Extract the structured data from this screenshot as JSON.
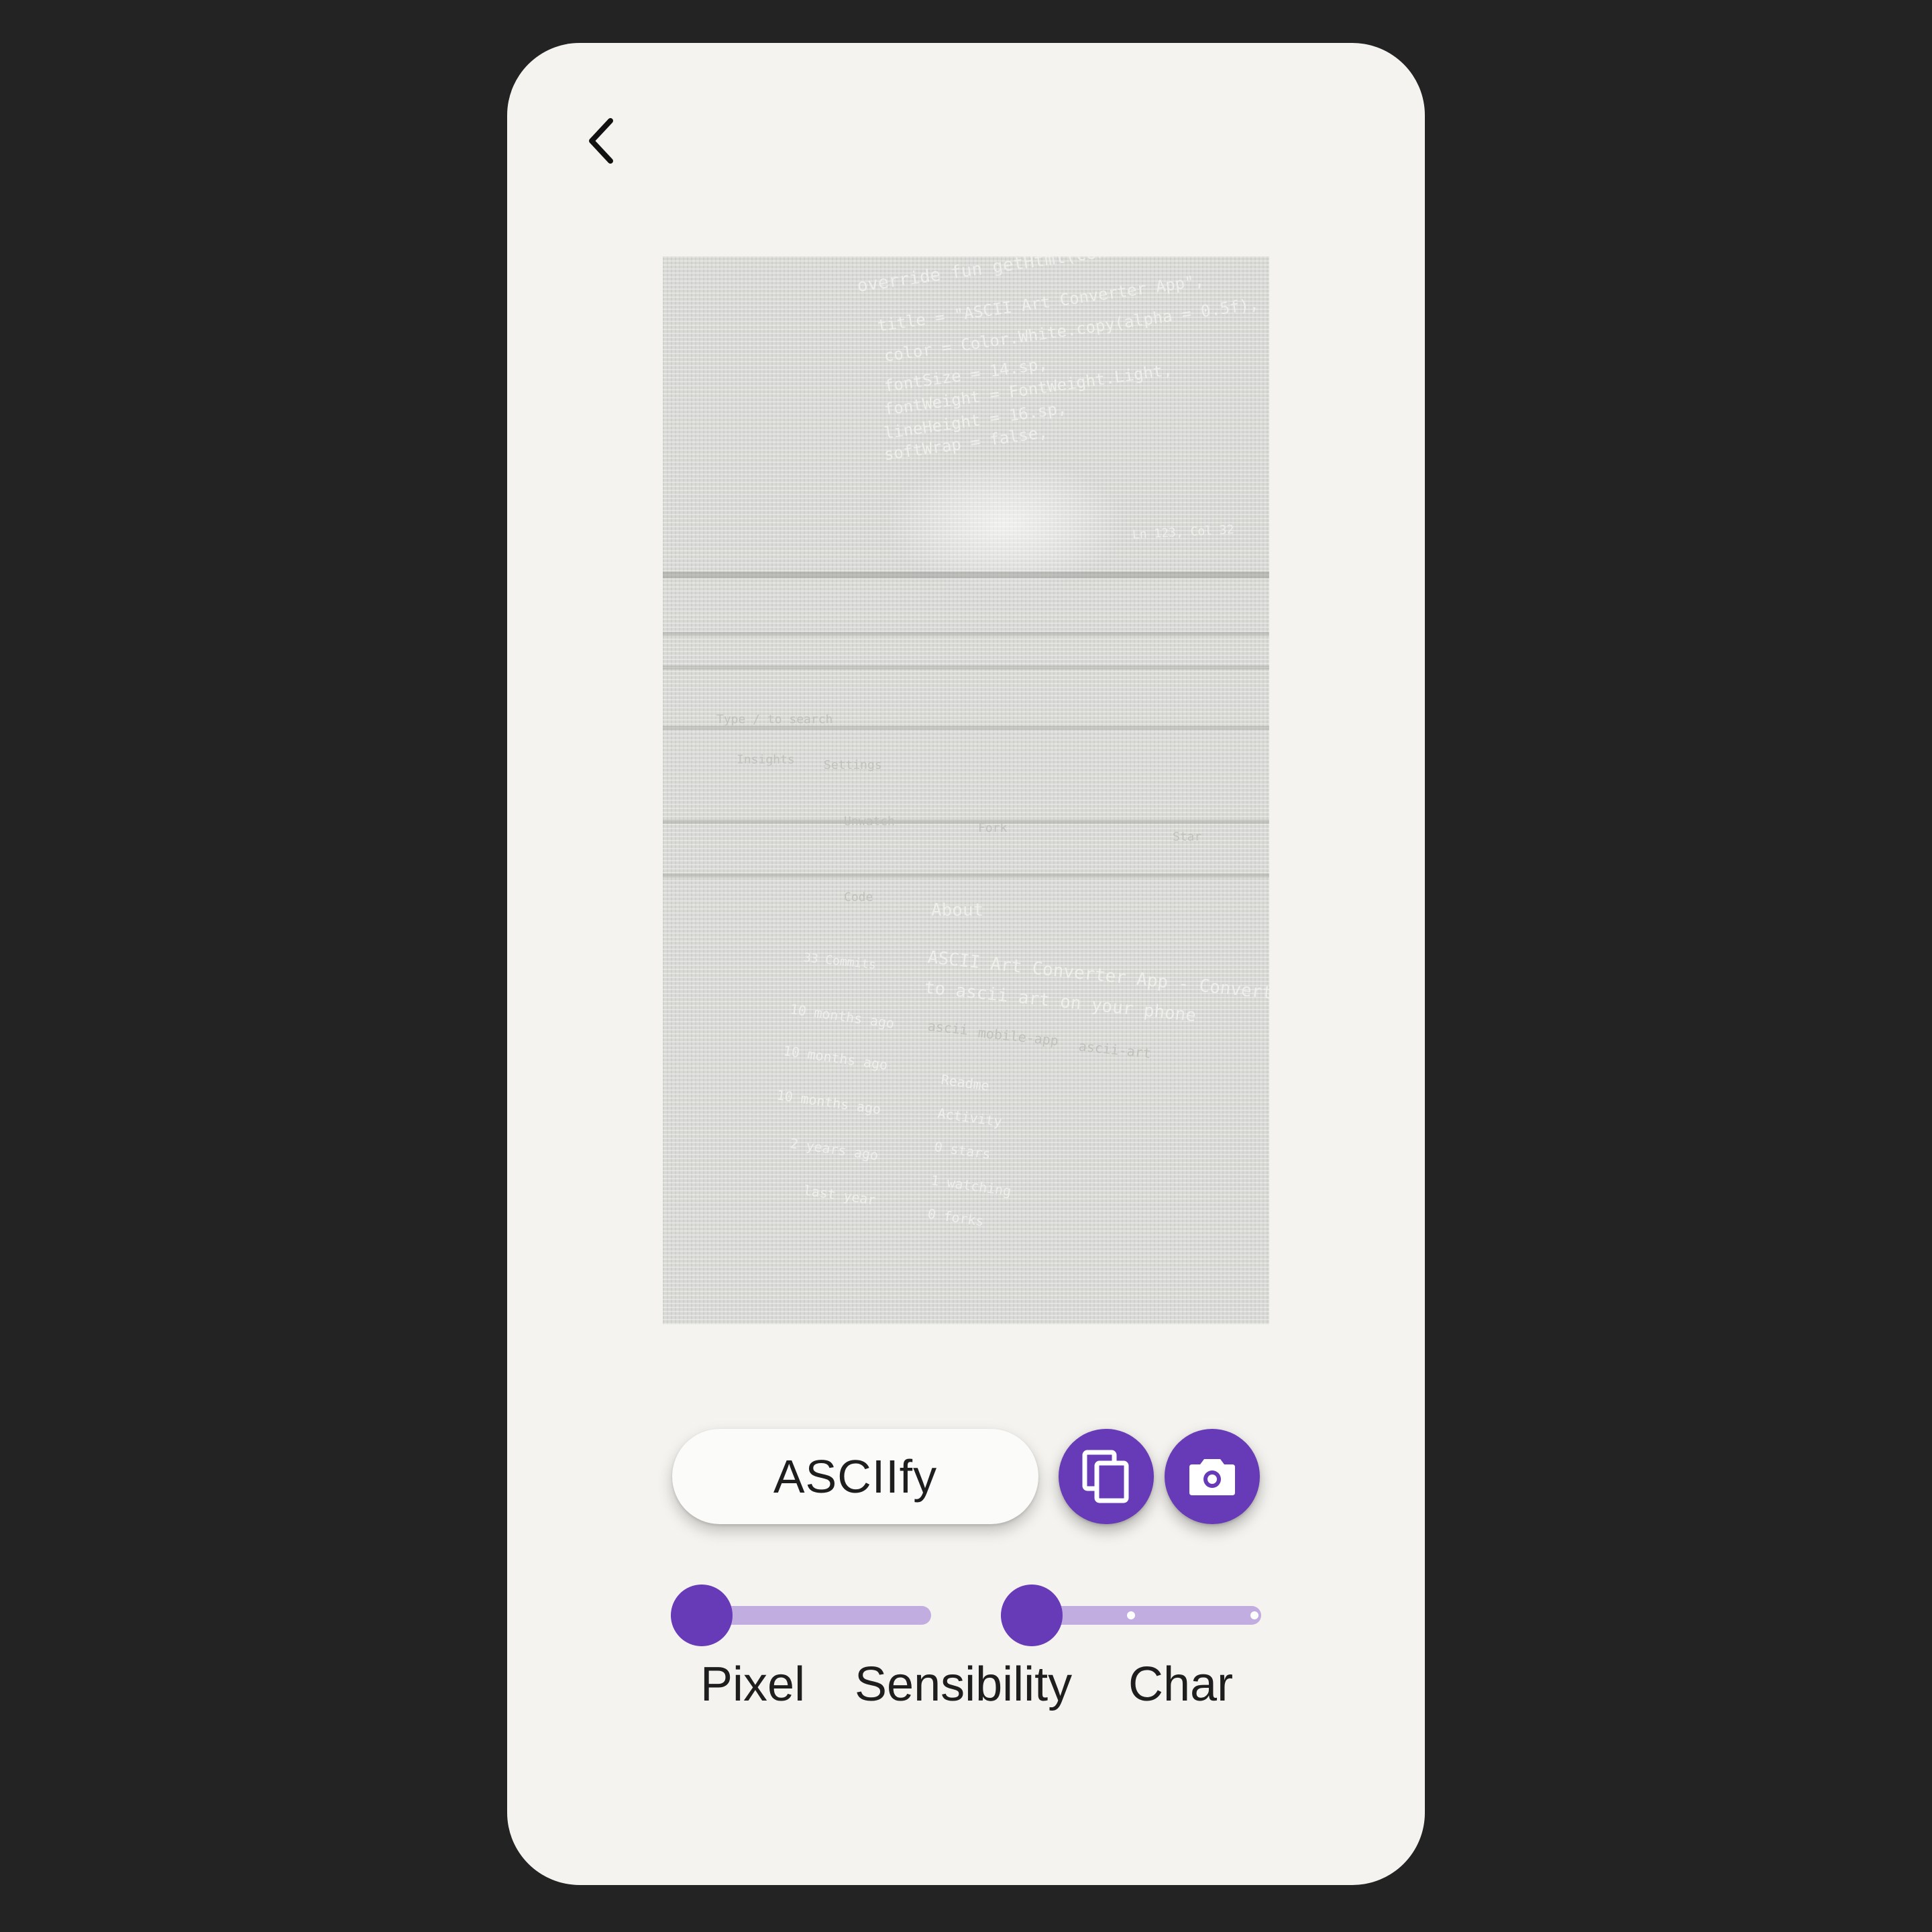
{
  "app": {
    "accent_color": "#673ab7",
    "accent_light_color": "#c1addf",
    "background_color": "#f4f3ef"
  },
  "nav": {
    "back_icon": "chevron-left-icon"
  },
  "preview": {
    "description_lines": [
      "override fun getHtml(context: Context) {",
      "title = \"ASCII Art Converter App\",",
      "color = Color.White.copy(alpha = 0.5f),",
      "fontSize = 14.sp,",
      "fontWeight = FontWeight.Light,",
      "lineHeight = 16.sp,",
      "softWrap = false,",
      "Ln 123, Col 32",
      "Type / to search",
      "Insights",
      "Settings",
      "Unwatch",
      "Fork",
      "Star",
      "Code",
      "About",
      "33 Commits",
      "ASCII Art Converter App - Convert images",
      "to ascii art on your phone",
      "ascii",
      "mobile-app",
      "ascii-art",
      "10 months ago",
      "10 months ago",
      "10 months ago",
      "2 years ago",
      "last year",
      "Readme",
      "Activity",
      "0 stars",
      "1 watching",
      "0 forks"
    ]
  },
  "actions": {
    "asciify_label": "ASCIIfy",
    "copy_icon": "copy-icon",
    "camera_icon": "camera-icon"
  },
  "controls": {
    "pixel_slider_value": 0,
    "char_slider_value": 0,
    "char_slider_steps": 3,
    "labels": {
      "pixel": "Pixel",
      "sensibility": "Sensibility",
      "char": "Char"
    }
  }
}
